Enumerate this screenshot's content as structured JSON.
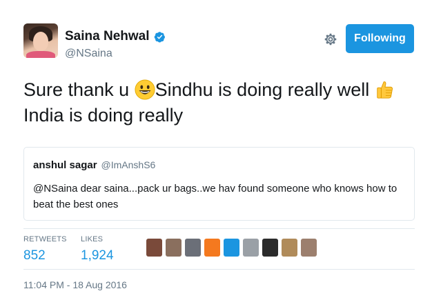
{
  "author": {
    "display_name": "Saina Nehwal",
    "handle": "@NSaina",
    "verified": true,
    "avatar_icon": "profile-photo"
  },
  "actions": {
    "settings_icon": "gear-icon",
    "follow_label": "Following"
  },
  "tweet": {
    "text_part1": "Sure thank u ",
    "emoji1": "smiley-face",
    "text_part2": "Sindhu is doing really well ",
    "emoji2": "thumbs-up",
    "text_part3": "India is doing really"
  },
  "quoted_tweet": {
    "name": "anshul sagar",
    "handle": "@ImAnshS6",
    "text": "@NSaina dear saina...pack ur bags..we hav found someone who knows how to beat the best ones"
  },
  "stats": {
    "retweets_label": "RETWEETS",
    "retweets_value": "852",
    "likes_label": "LIKES",
    "likes_value": "1,924"
  },
  "likers": [
    {
      "name": "liker-avatar-1",
      "color": "#7a4a3a"
    },
    {
      "name": "liker-avatar-2",
      "color": "#8a6f5e"
    },
    {
      "name": "liker-avatar-3",
      "color": "#6b6f78"
    },
    {
      "name": "liker-avatar-4",
      "color": "#f4791f"
    },
    {
      "name": "liker-avatar-5",
      "color": "#1b95e0"
    },
    {
      "name": "liker-avatar-6",
      "color": "#9aa0a6"
    },
    {
      "name": "liker-avatar-7",
      "color": "#2b2b2b"
    },
    {
      "name": "liker-avatar-8",
      "color": "#b08b5a"
    },
    {
      "name": "liker-avatar-9",
      "color": "#9c7f6e"
    }
  ],
  "timestamp": "11:04 PM - 18 Aug 2016",
  "colors": {
    "accent": "#1b95e0",
    "secondary_text": "#657786",
    "border": "#e1e8ed"
  }
}
